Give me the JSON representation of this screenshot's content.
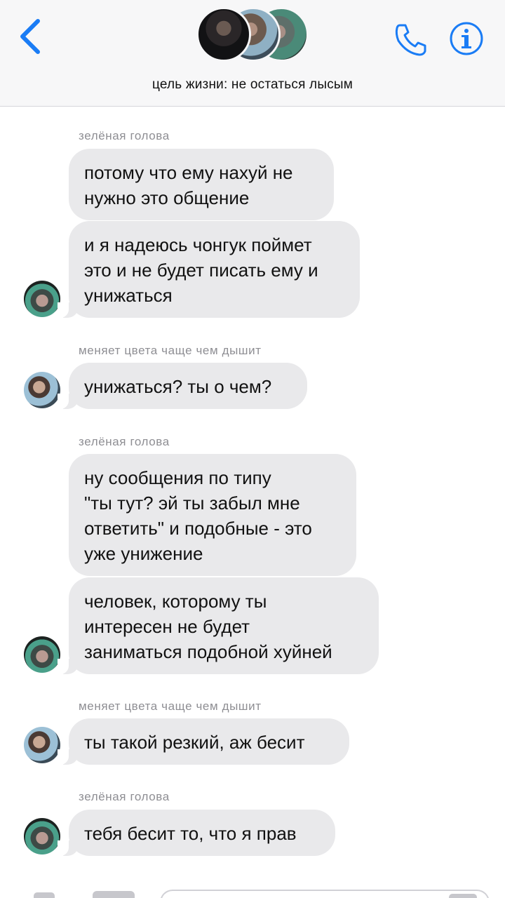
{
  "header": {
    "title": "цель жизни: не остаться лысым",
    "back_icon": "chevron-left-icon",
    "call_icon": "phone-icon",
    "info_icon": "info-icon",
    "accent_color": "#1a7cf5"
  },
  "messages": [
    {
      "sender": "зелёная голова"
    },
    {
      "text": "потому что ему нахуй не\nнужно это общение"
    },
    {
      "text": "и я надеюсь чонгук поймет\nэто и не будет писать ему и\nунижаться"
    },
    {
      "sender": "меняет цвета чаще чем дышит"
    },
    {
      "text": "унижаться? ты о чем?"
    },
    {
      "sender": "зелёная голова"
    },
    {
      "text": "ну сообщения по типу\n\"ты тут? эй ты забыл мне\nответить\" и подобные - это\nуже унижение"
    },
    {
      "text": "человек, которому ты\nинтересен не будет\nзаниматься подобной хуйней"
    },
    {
      "sender": "меняет цвета чаще чем дышит"
    },
    {
      "text": "ты такой резкий, аж бесит"
    },
    {
      "sender": "зелёная голова"
    },
    {
      "text": "тебя бесит то, что я прав"
    }
  ],
  "colors": {
    "bubble": "#e9e9eb",
    "sender_text": "#8e8e93",
    "header_bg": "#f7f7f8"
  }
}
